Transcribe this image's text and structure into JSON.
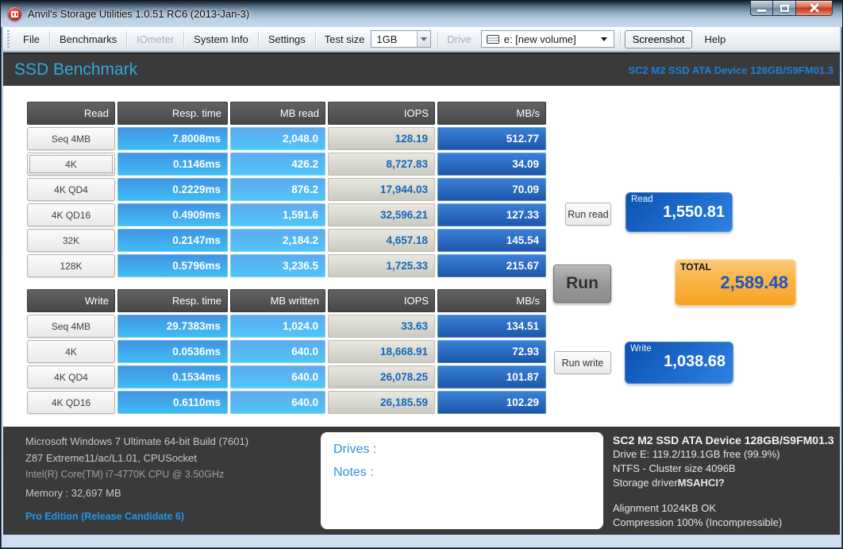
{
  "window": {
    "title": "Anvil's Storage Utilities 1.0.51 RC6 (2013-Jan-3)"
  },
  "menu": {
    "file": "File",
    "benchmarks": "Benchmarks",
    "iometer": "IOmeter",
    "system_info": "System Info",
    "settings": "Settings",
    "test_size_label": "Test size",
    "test_size_value": "1GB",
    "drive_label": "Drive",
    "drive_value": "e: [new volume]",
    "screenshot": "Screenshot",
    "help": "Help"
  },
  "banner": {
    "title": "SSD Benchmark",
    "device": "SC2 M2 SSD ATA Device 128GB/S9FM01.3"
  },
  "read_table": {
    "headers": [
      "Read",
      "Resp. time",
      "MB read",
      "IOPS",
      "MB/s"
    ],
    "rows": [
      {
        "label": "Seq 4MB",
        "resp": "7.8008ms",
        "mb": "2,048.0",
        "iops": "128.19",
        "mbs": "512.77"
      },
      {
        "label": "4K",
        "resp": "0.1146ms",
        "mb": "426.2",
        "iops": "8,727.83",
        "mbs": "34.09"
      },
      {
        "label": "4K QD4",
        "resp": "0.2229ms",
        "mb": "876.2",
        "iops": "17,944.03",
        "mbs": "70.09"
      },
      {
        "label": "4K QD16",
        "resp": "0.4909ms",
        "mb": "1,591.6",
        "iops": "32,596.21",
        "mbs": "127.33"
      },
      {
        "label": "32K",
        "resp": "0.2147ms",
        "mb": "2,184.2",
        "iops": "4,657.18",
        "mbs": "145.54"
      },
      {
        "label": "128K",
        "resp": "0.5796ms",
        "mb": "3,236.5",
        "iops": "1,725.33",
        "mbs": "215.67"
      }
    ]
  },
  "write_table": {
    "headers": [
      "Write",
      "Resp. time",
      "MB written",
      "IOPS",
      "MB/s"
    ],
    "rows": [
      {
        "label": "Seq 4MB",
        "resp": "29.7383ms",
        "mb": "1,024.0",
        "iops": "33.63",
        "mbs": "134.51"
      },
      {
        "label": "4K",
        "resp": "0.0536ms",
        "mb": "640.0",
        "iops": "18,668.91",
        "mbs": "72.93"
      },
      {
        "label": "4K QD4",
        "resp": "0.1534ms",
        "mb": "640.0",
        "iops": "26,078.25",
        "mbs": "101.87"
      },
      {
        "label": "4K QD16",
        "resp": "0.6110ms",
        "mb": "640.0",
        "iops": "26,185.59",
        "mbs": "102.29"
      }
    ]
  },
  "actions": {
    "run_read": "Run read",
    "run": "Run",
    "run_write": "Run write"
  },
  "scores": {
    "read_label": "Read",
    "read_value": "1,550.81",
    "total_label": "TOTAL",
    "total_value": "2,589.48",
    "write_label": "Write",
    "write_value": "1,038.68"
  },
  "footer": {
    "os": "Microsoft Windows 7 Ultimate  64-bit Build (7601)",
    "board": "Z87 Extreme11/ac/L1.01, CPUSocket",
    "cpu": "Intel(R) Core(TM) i7-4770K CPU @ 3.50GHz",
    "memory": "Memory : 32,697 MB",
    "edition": "Pro Edition (Release Candidate 6)",
    "drives_label": "Drives :",
    "notes_label": "Notes :",
    "device": "SC2 M2 SSD ATA Device 128GB/S9FM01.3",
    "drive_free": "Drive E: 119.2/119.1GB free (99.9%)",
    "filesystem": "NTFS - Cluster size 4096B",
    "storage_driver_label": "Storage driver",
    "storage_driver_value": "MSAHCI?",
    "alignment": "Alignment 1024KB OK",
    "compression": "Compression 100% (Incompressible)"
  }
}
